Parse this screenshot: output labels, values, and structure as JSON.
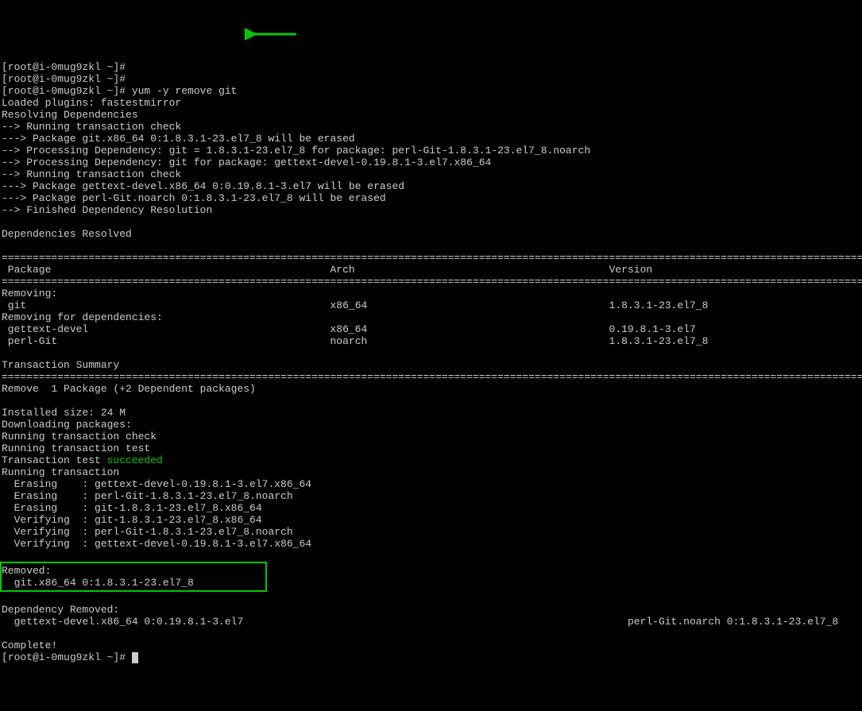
{
  "prompt1": "[root@i-0mug9zkl ~]# ",
  "prompt2": "[root@i-0mug9zkl ~]# ",
  "prompt3": "[root@i-0mug9zkl ~]# ",
  "command": "yum -y remove git",
  "lines": {
    "loaded": "Loaded plugins: fastestmirror",
    "resolving": "Resolving Dependencies",
    "check1": "--> Running transaction check",
    "pkg1": "---> Package git.x86_64 0:1.8.3.1-23.el7_8 will be erased",
    "dep1": "--> Processing Dependency: git = 1.8.3.1-23.el7_8 for package: perl-Git-1.8.3.1-23.el7_8.noarch",
    "dep2": "--> Processing Dependency: git for package: gettext-devel-0.19.8.1-3.el7.x86_64",
    "check2": "--> Running transaction check",
    "pkg2": "---> Package gettext-devel.x86_64 0:0.19.8.1-3.el7 will be erased",
    "pkg3": "---> Package perl-Git.noarch 0:1.8.3.1-23.el7_8 will be erased",
    "finished": "--> Finished Dependency Resolution",
    "depsResolved": "Dependencies Resolved"
  },
  "tableHeaders": {
    "package": " Package",
    "arch": "Arch",
    "version": "Version"
  },
  "tableBody": {
    "removingHdr": "Removing:",
    "row1pkg": " git",
    "row1arch": "x86_64",
    "row1ver": "1.8.3.1-23.el7_8",
    "removingDepsHdr": "Removing for dependencies:",
    "row2pkg": " gettext-devel",
    "row2arch": "x86_64",
    "row2ver": "0.19.8.1-3.el7",
    "row3pkg": " perl-Git",
    "row3arch": "noarch",
    "row3ver": "1.8.3.1-23.el7_8"
  },
  "summary": {
    "title": "Transaction Summary",
    "remove": "Remove  1 Package (+2 Dependent packages)",
    "size": "Installed size: 24 M",
    "dl": "Downloading packages:",
    "check": "Running transaction check",
    "test": "Running transaction test",
    "testResult": "Transaction test ",
    "succeeded": "succeeded",
    "running": "Running transaction",
    "e1": "  Erasing    : gettext-devel-0.19.8.1-3.el7.x86_64",
    "e2": "  Erasing    : perl-Git-1.8.3.1-23.el7_8.noarch",
    "e3": "  Erasing    : git-1.8.3.1-23.el7_8.x86_64",
    "v1": "  Verifying  : git-1.8.3.1-23.el7_8.x86_64",
    "v2": "  Verifying  : perl-Git-1.8.3.1-23.el7_8.noarch",
    "v3": "  Verifying  : gettext-devel-0.19.8.1-3.el7.x86_64"
  },
  "removed": {
    "hdr": "Removed:",
    "pkg": "  git.x86_64 0:1.8.3.1-23.el7_8"
  },
  "depRemoved": {
    "hdr": "Dependency Removed:",
    "pkg1": "  gettext-devel.x86_64 0:0.19.8.1-3.el7",
    "pkg2": "perl-Git.noarch 0:1.8.3.1-23.el7_8"
  },
  "complete": "Complete!",
  "finalPrompt": "[root@i-0mug9zkl ~]# ",
  "rule": "==================================================================================================================================================="
}
